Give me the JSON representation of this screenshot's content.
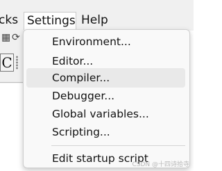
{
  "menubar": {
    "items": [
      "cks",
      "Settings",
      "Help"
    ]
  },
  "toolbar": {
    "c_label": "C"
  },
  "settings_menu": {
    "items": [
      "Environment...",
      "Editor...",
      "Compiler...",
      "Debugger...",
      "Global variables...",
      "Scripting...",
      "Edit startup script"
    ],
    "hovered_index": 2
  },
  "watermark": "CSDN @十四诗拾寺"
}
